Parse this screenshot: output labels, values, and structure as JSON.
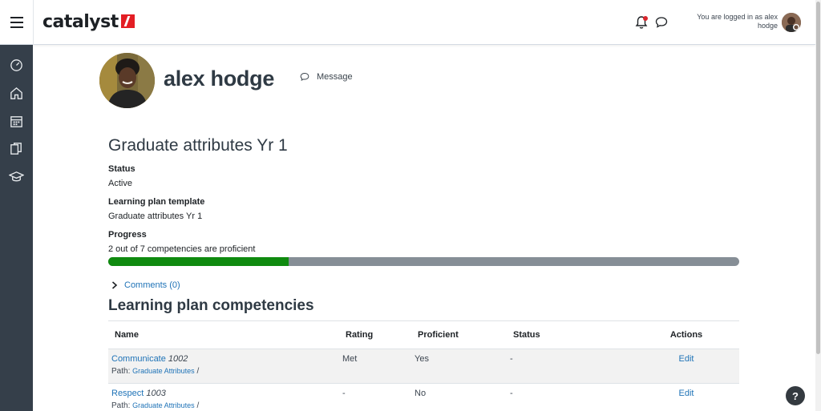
{
  "header": {
    "brand": "catalyst",
    "login_text": "You are logged in as alex hodge"
  },
  "profile": {
    "name": "alex hodge",
    "message_label": "Message"
  },
  "plan": {
    "title": "Graduate attributes Yr 1",
    "status_label": "Status",
    "status_value": "Active",
    "template_label": "Learning plan template",
    "template_value": "Graduate attributes Yr 1",
    "progress_label": "Progress",
    "progress_text": "2 out of 7 competencies are proficient",
    "progress_fraction": 0.2857,
    "comments_label": "Comments (0)"
  },
  "competencies": {
    "title": "Learning plan competencies",
    "headers": {
      "name": "Name",
      "rating": "Rating",
      "proficient": "Proficient",
      "status": "Status",
      "actions": "Actions"
    },
    "path_prefix": "Path:",
    "rows": [
      {
        "name": "Communicate",
        "idnumber": "1002",
        "path": "Graduate Attributes",
        "path_sep": "/",
        "rating": "Met",
        "proficient": "Yes",
        "status": "-",
        "action": "Edit"
      },
      {
        "name": "Respect",
        "idnumber": "1003",
        "path": "Graduate Attributes",
        "path_sep": "/",
        "rating": "-",
        "proficient": "No",
        "status": "-",
        "action": "Edit"
      }
    ]
  },
  "help": {
    "label": "?"
  },
  "colors": {
    "accent": "#1f73b7",
    "progress": "#0f8a0f",
    "drawer": "#353f4a",
    "brand": "#e31e24"
  }
}
